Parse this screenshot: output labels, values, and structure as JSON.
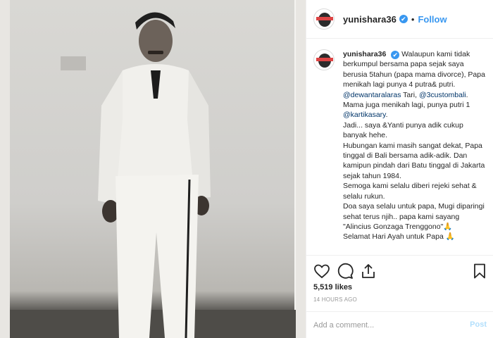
{
  "post": {
    "username": "yunishara36",
    "verified_mark": "✔",
    "follow_label": "Follow",
    "separator": "•"
  },
  "caption": {
    "username": "yunishara36",
    "parts": {
      "p1a": "Walaupun kami tidak berkumpul bersama papa sejak saya berusia 5tahun (papa mama divorce), Papa menikah lagi punya 4 putra& putri. ",
      "m1": "@dewantaralaras",
      "p1b": " Tari, ",
      "m2": "@3custombali",
      "p1c": ". Mama juga menikah lagi, punya putri 1 ",
      "m3": "@kartikasary",
      "p1d": ".",
      "p2": "Jadi... saya &Yanti punya adik cukup banyak hehe.",
      "p3": "Hubungan kami masih sangat dekat, Papa tinggal di Bali bersama adik-adik. Dan kamipun pindah dari Batu tinggal di Jakarta sejak tahun 1984.",
      "p4": "Semoga kami selalu diberi rejeki sehat & selalu rukun.",
      "p5": "Doa saya selalu untuk papa, Mugi diparingi sehat terus njih.. papa kami sayang \"Alincius Gonzaga Trenggono\"🙏",
      "p6": "Selamat Hari Ayah untuk Papa 🙏"
    }
  },
  "stats": {
    "likes": "5,519 likes",
    "time": "14 HOURS AGO"
  },
  "comment": {
    "placeholder": "Add a comment...",
    "post_label": "Post"
  },
  "icons": {
    "like": "heart-icon",
    "comment": "comment-icon",
    "share": "share-icon",
    "save": "bookmark-icon"
  },
  "colors": {
    "accent": "#3897f0",
    "post_disabled": "#b2dffc",
    "mention": "#003569"
  }
}
